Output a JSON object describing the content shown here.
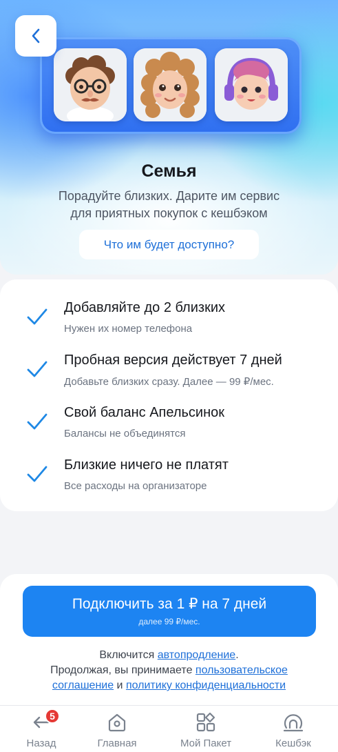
{
  "hero": {
    "title": "Семья",
    "subtitle_line1": "Порадуйте близких. Дарите им сервис",
    "subtitle_line2": "для приятных покупок с кешбэком",
    "info_button": "Что им будет доступно?"
  },
  "avatars": [
    {
      "name": "avatar-man-glasses",
      "skin": "#f3c6a6",
      "hair": "#7a4a2c"
    },
    {
      "name": "avatar-woman-curly",
      "skin": "#f5c9ad",
      "hair": "#c98a4e"
    },
    {
      "name": "avatar-kid-headphones",
      "skin": "#f7cdb4",
      "hair": "#d46aa0"
    }
  ],
  "features": [
    {
      "title": "Добавляйте до 2 близких",
      "subtitle": "Нужен их номер телефона"
    },
    {
      "title": "Пробная версия действует 7 дней",
      "subtitle": "Добавьте близких сразу. Далее — 99 ₽/мес."
    },
    {
      "title": "Свой баланс Апельсинок",
      "subtitle": "Балансы не объединятся"
    },
    {
      "title": "Близкие ничего не платят",
      "subtitle": "Все расходы на организаторе"
    }
  ],
  "cta": {
    "label": "Подключить за 1 ₽ на 7 дней",
    "sublabel": "далее 99 ₽/мес."
  },
  "legal": {
    "line1_prefix": "Включится ",
    "line1_link": "автопродление",
    "line1_suffix": ".",
    "line2_prefix": "Продолжая, вы принимаете ",
    "line2_link": "пользовательское",
    "line3_link": "соглашение",
    "line3_mid": " и ",
    "line3_link2": "политику конфиденциальности"
  },
  "nav": {
    "items": [
      {
        "label": "Назад",
        "icon": "back-arrow-icon",
        "badge": "5"
      },
      {
        "label": "Главная",
        "icon": "home-icon"
      },
      {
        "label": "Мой Пакет",
        "icon": "package-icon"
      },
      {
        "label": "Кешбэк",
        "icon": "cashback-icon"
      }
    ]
  },
  "colors": {
    "accent": "#1d84f2",
    "link": "#1d6fd8",
    "check": "#1e88e5",
    "badge": "#e53935"
  }
}
